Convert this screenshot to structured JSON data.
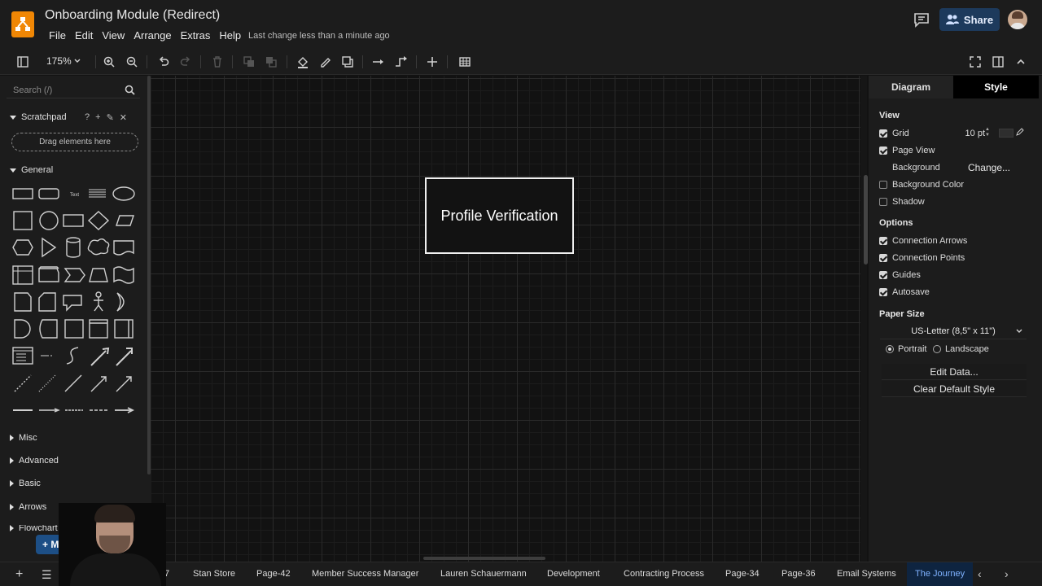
{
  "app": {
    "title": "Onboarding Module (Redirect)",
    "last_change": "Last change less than a minute ago",
    "brand_color": "#f08705"
  },
  "menu": [
    "File",
    "Edit",
    "View",
    "Arrange",
    "Extras",
    "Help"
  ],
  "header": {
    "share_label": "Share",
    "share_color": "#1d3a5c"
  },
  "toolbar": {
    "zoom": "175%"
  },
  "sidebar": {
    "search_placeholder": "Search (/)",
    "scratchpad_label": "Scratchpad",
    "drag_hint": "Drag elements here",
    "general_label": "General",
    "collapsed_sections": [
      "Misc",
      "Advanced",
      "Basic",
      "Arrows",
      "Flowchart"
    ],
    "more_shapes": "+ More Shapes"
  },
  "canvas": {
    "node_label": "Profile Verification"
  },
  "panel": {
    "tab_diagram": "Diagram",
    "tab_style": "Style",
    "view_heading": "View",
    "grid_label": "Grid",
    "grid_size": "10 pt",
    "page_view_label": "Page View",
    "background_label": "Background",
    "change_label": "Change...",
    "background_color_label": "Background Color",
    "shadow_label": "Shadow",
    "options_heading": "Options",
    "connection_arrows_label": "Connection Arrows",
    "connection_points_label": "Connection Points",
    "guides_label": "Guides",
    "autosave_label": "Autosave",
    "paper_size_heading": "Paper Size",
    "paper_size_value": "US-Letter (8,5\" x 11\")",
    "portrait_label": "Portrait",
    "landscape_label": "Landscape",
    "edit_data_label": "Edit Data...",
    "clear_style_label": "Clear Default Style",
    "checks": {
      "grid": true,
      "page_view": true,
      "background_color": false,
      "shadow": false,
      "connection_arrows": true,
      "connection_points": true,
      "guides": true,
      "autosave": true
    }
  },
  "pages": {
    "partial_first": "7",
    "tabs": [
      "Stan Store",
      "Page-42",
      "Member Success Manager",
      "Lauren Schauermann",
      "Development",
      "Contracting Process",
      "Page-34",
      "Page-36",
      "Email Systems",
      "The Journey"
    ],
    "active": "The Journey",
    "active_color": "#7fb2ff"
  }
}
